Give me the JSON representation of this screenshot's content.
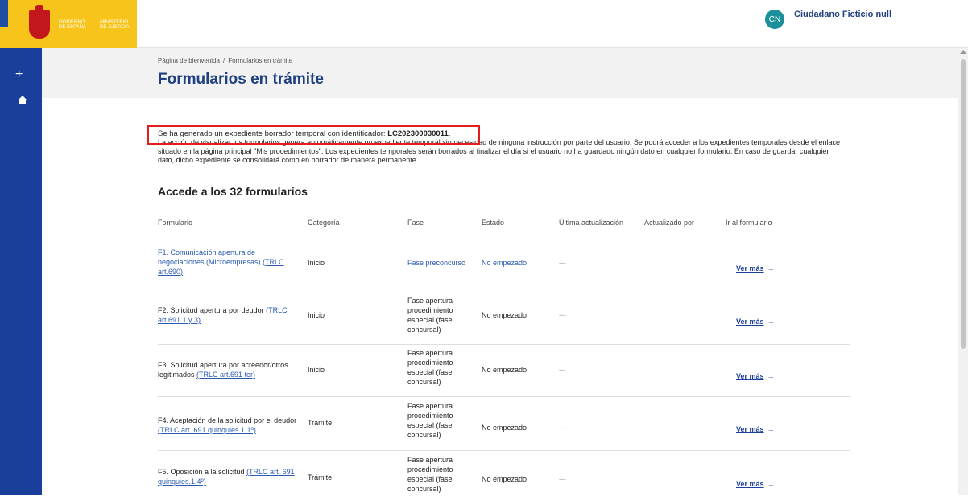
{
  "header": {
    "logo_gobierno": "GOBIERNO\nDE ESPAÑA",
    "logo_ministerio": "MINISTERIO\nDE JUSTICIA",
    "user_initials": "CN",
    "user_name": "Ciudadano Ficticio null"
  },
  "sidenav": {
    "add_label": "+"
  },
  "breadcrumb": {
    "home": "Página de bienvenida",
    "separator": "/",
    "current": "Formularios en trámite"
  },
  "page_title": "Formularios en trámite",
  "notice": {
    "line1_prefix": "Se ha generado un expediente borrador temporal con identificador: ",
    "identifier": "LC202300030011",
    "line1_suffix": ".",
    "line1_hidden": "La acción de visualizar los formularios genera automáticamente un expediente temporal sin necesidad de ninguna instrucción por parte del usuario. Se podrá acceder a los expedientes temporales desde el enlace situado en la página principal \"Mis procedimientos\". Los expedientes temporales serán borrados al finalizar el día si el usuario no ha guardado ningún dato en cualquier formulario. En caso de guardar cualquier dato, dicho expediente se consolidará como en borrador de manera permanente."
  },
  "section_title": "Accede a los 32 formularios",
  "table": {
    "headers": [
      "Formulario",
      "Categoría",
      "Fase",
      "Estado",
      "Última actualización",
      "Actualizado por",
      "Ir al formulario"
    ],
    "rows": [
      {
        "form_text": "F1. Comunicación apertura de negociaciones (Microempresas) ",
        "form_link": "(TRLC art.690)",
        "categoria": "Inicio",
        "fase": "Fase preconcurso",
        "estado": "No empezado",
        "ultima": "---",
        "actualizado_por": "",
        "ir": "Ver más"
      },
      {
        "form_text": "F2. Solicitud apertura por deudor  ",
        "form_link": "(TRLC art.691.1 y 3)",
        "categoria": "Inicio",
        "fase": "Fase apertura procedimiento especial (fase concursal)",
        "estado": "No empezado",
        "ultima": "---",
        "actualizado_por": "",
        "ir": "Ver más"
      },
      {
        "form_text": "F3. Solicitud apertura por acreedor/otros legitimados  ",
        "form_link": "(TRLC art.691 ter)",
        "categoria": "Inicio",
        "fase": "Fase apertura procedimiento especial (fase concursal)",
        "estado": "No empezado",
        "ultima": "---",
        "actualizado_por": "",
        "ir": "Ver más"
      },
      {
        "form_text": "F4. Aceptación de la solicitud por el deudor ",
        "form_link": "(TRLC art. 691 quinquies.1.1º)",
        "categoria": "Trámite",
        "fase": "Fase apertura procedimiento especial (fase concursal)",
        "estado": "No empezado",
        "ultima": "---",
        "actualizado_por": "",
        "ir": "Ver más"
      },
      {
        "form_text": "F5. Oposición a la solicitud  ",
        "form_link": "(TRLC art. 691 quinquies.1.4º)",
        "categoria": "Trámite",
        "fase": "Fase apertura procedimiento especial (fase concursal)",
        "estado": "No empezado",
        "ultima": "---",
        "actualizado_por": "",
        "ir": "Ver más"
      }
    ]
  },
  "colors": {
    "brand_blue": "#1a3f9a",
    "title_blue": "#204080",
    "highlight_red": "#e41c1c"
  }
}
